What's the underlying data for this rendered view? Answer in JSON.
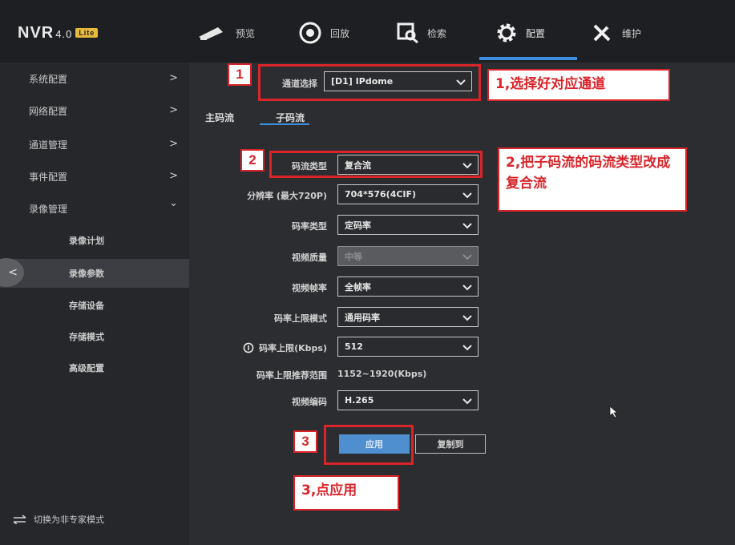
{
  "app": {
    "logo": "NVR",
    "version": "4.0",
    "edition": "Lite"
  },
  "nav": [
    {
      "icon": "camera-icon",
      "label": "预览"
    },
    {
      "icon": "playback-icon",
      "label": "回放"
    },
    {
      "icon": "search-icon",
      "label": "检索"
    },
    {
      "icon": "gear-icon",
      "label": "配置",
      "active": true
    },
    {
      "icon": "tools-icon",
      "label": "维护"
    }
  ],
  "sidebar": {
    "items": [
      {
        "label": "系统配置",
        "arrow": ">"
      },
      {
        "label": "网络配置",
        "arrow": ">"
      },
      {
        "label": "通道管理",
        "arrow": ">"
      },
      {
        "label": "事件配置",
        "arrow": ">"
      },
      {
        "label": "录像管理",
        "arrow": "⌄"
      }
    ],
    "subitems": [
      {
        "label": "录像计划"
      },
      {
        "label": "录像参数",
        "active": true
      },
      {
        "label": "存储设备"
      },
      {
        "label": "存储模式"
      },
      {
        "label": "高级配置"
      }
    ],
    "mode_switch": "切换为非专家模式"
  },
  "channel": {
    "label": "通道选择",
    "value": "[D1] IPdome"
  },
  "tabs": [
    {
      "label": "主码流"
    },
    {
      "label": "子码流",
      "active": true
    }
  ],
  "form": {
    "stream_type": {
      "label": "码流类型",
      "value": "复合流"
    },
    "resolution": {
      "label": "分辨率 (最大720P)",
      "value": "704*576(4CIF)"
    },
    "bitrate_type": {
      "label": "码率类型",
      "value": "定码率"
    },
    "video_quality": {
      "label": "视频质量",
      "value": "中等"
    },
    "frame_rate": {
      "label": "视频帧率",
      "value": "全帧率"
    },
    "bitrate_limit_mode": {
      "label": "码率上限模式",
      "value": "通用码率"
    },
    "bitrate_limit": {
      "label": "码率上限(Kbps)",
      "value": "512"
    },
    "recommended_range": {
      "label": "码率上限推荐范围",
      "value": "1152~1920(Kbps)"
    },
    "video_codec": {
      "label": "视频编码",
      "value": "H.265"
    }
  },
  "buttons": {
    "apply": "应用",
    "copy": "复制到"
  },
  "annotations": {
    "num1": "1",
    "num2": "2",
    "num3": "3",
    "callout1": "1,选择好对应通道",
    "callout2": "2,把子码流的码流类型改成复合流",
    "callout3": "3,点应用"
  },
  "colors": {
    "accent": "#3c8fe0",
    "annotation_red": "#d9242a"
  }
}
